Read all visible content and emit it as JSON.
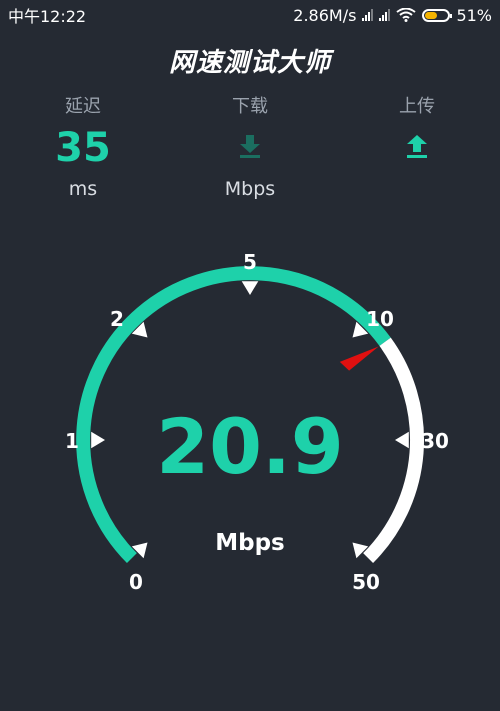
{
  "status_bar": {
    "time": "中午12:22",
    "network_speed": "2.86M/s",
    "battery_percent": "51%",
    "battery_level": 0.51,
    "battery_color": "#f5b400"
  },
  "app": {
    "title": "网速测试大师"
  },
  "stats": {
    "latency": {
      "label": "延迟",
      "value": "35",
      "unit": "ms"
    },
    "download": {
      "label": "下载",
      "unit": "Mbps",
      "icon": "download-icon"
    },
    "upload": {
      "label": "上传",
      "icon": "upload-icon"
    }
  },
  "gauge": {
    "speed_value": "20.9",
    "unit": "Mbps",
    "current_speed": 20.9,
    "scale_labels": [
      "0",
      "1",
      "2",
      "5",
      "10",
      "30",
      "50"
    ],
    "filled_fraction": 0.7,
    "colors": {
      "accent": "#1ed1aa",
      "track": "#ffffff",
      "needle": "#e01010",
      "background": "#252a33"
    }
  }
}
